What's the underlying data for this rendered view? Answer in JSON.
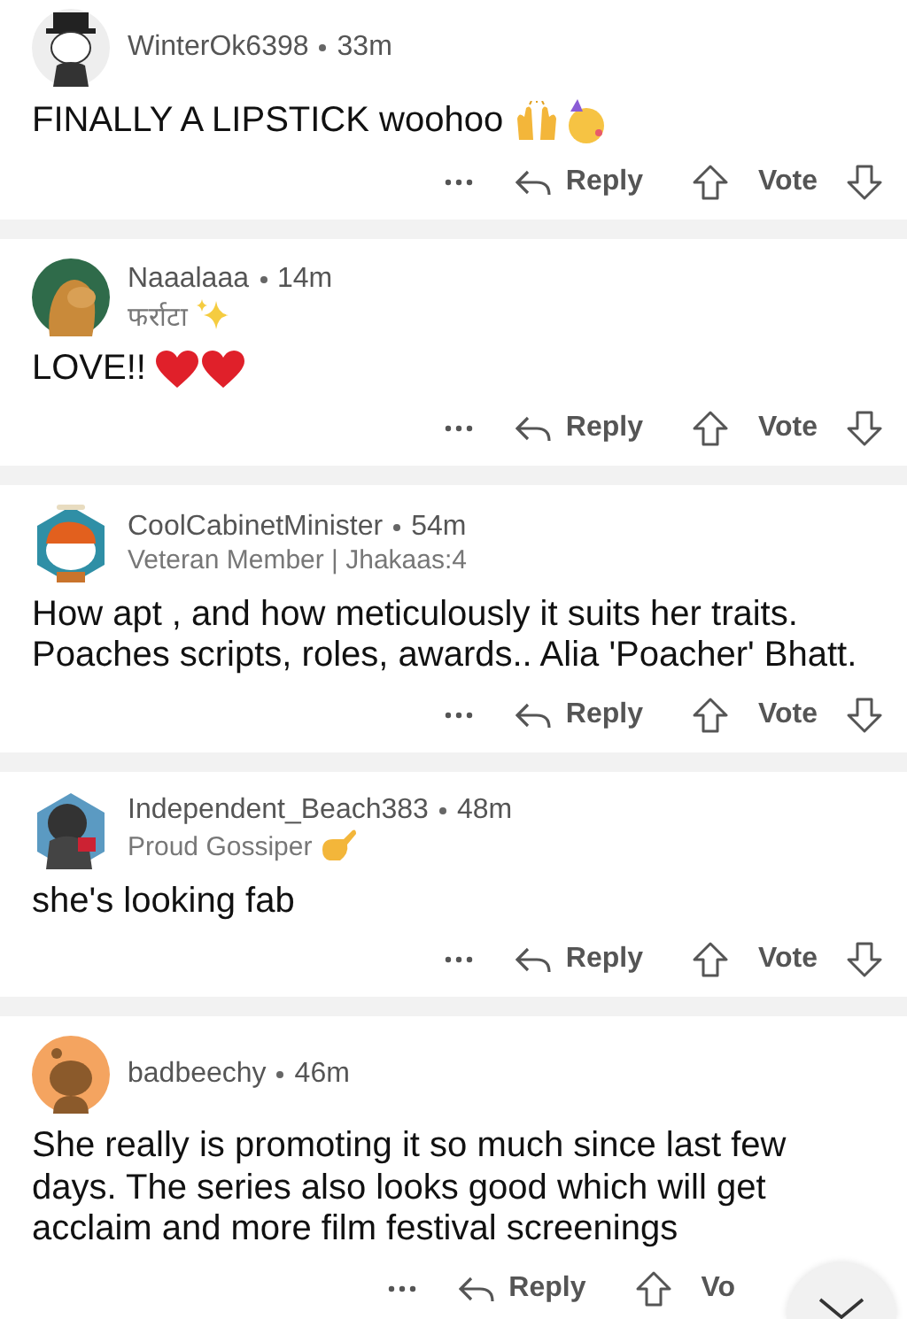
{
  "comments": [
    {
      "avatar": {
        "kind": "hat-figure"
      },
      "author": "WinterOk6398",
      "time": "33m",
      "body": "FINALLY A LIPSTICK woohoo",
      "emojis": [
        {
          "kind": "raised-hands"
        },
        {
          "kind": "party-face"
        }
      ],
      "actions": {
        "reply": "Reply",
        "vote": "Vote"
      }
    },
    {
      "avatar": {
        "kind": "animal"
      },
      "author": "Naaalaaa",
      "time": "14m",
      "flair": {
        "text": "फर्राटा",
        "emoji": {
          "kind": "sparkles"
        }
      },
      "body": "LOVE!!",
      "emojis": [
        {
          "kind": "heart"
        },
        {
          "kind": "heart"
        }
      ],
      "actions": {
        "reply": "Reply",
        "vote": "Vote"
      }
    },
    {
      "avatar": {
        "kind": "robot-hex"
      },
      "author": "CoolCabinetMinister",
      "time": "54m",
      "flair": {
        "text": "Veteran Member | Jhakaas:4"
      },
      "body": "How apt , and how meticulously it suits her traits. Poaches scripts, roles, awards.. Alia 'Poacher' Bhatt.",
      "actions": {
        "reply": "Reply",
        "vote": "Vote"
      }
    },
    {
      "avatar": {
        "kind": "dark-hex"
      },
      "author": "Independent_Beach383",
      "time": "48m",
      "flair": {
        "text": "Proud Gossiper",
        "emoji": {
          "kind": "call-hand"
        }
      },
      "body": "she's looking fab",
      "actions": {
        "reply": "Reply",
        "vote": "Vote"
      }
    },
    {
      "avatar": {
        "kind": "silhouette"
      },
      "author": "badbeechy",
      "time": "46m",
      "body": "She really is promoting it so much since last few days. The series also looks good which will get acclaim and more film festival screenings",
      "actions": {
        "reply": "Reply",
        "vote": "Vo"
      }
    }
  ]
}
